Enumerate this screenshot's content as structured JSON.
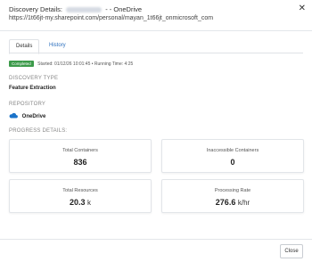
{
  "dialog": {
    "title_prefix": "Discovery Details:",
    "title_suffix": "- - OneDrive",
    "subtitle_url": "https://1t66jt-my.sharepoint.com/personal/mayan_1t66jt_onmicrosoft_com",
    "close_icon": "close-icon"
  },
  "tabs": [
    {
      "label": "Details",
      "active": true
    },
    {
      "label": "History",
      "active": false
    }
  ],
  "status": {
    "badge": "Completed",
    "text": "Started: 01/12/26 10:01:45 • Running Time: 4:25",
    "badge_color": "#3c9a4a"
  },
  "discovery_type": {
    "label": "DISCOVERY TYPE",
    "value": "Feature Extraction"
  },
  "repository": {
    "label": "REPOSITORY",
    "value": "OneDrive",
    "icon": "onedrive-cloud-icon",
    "icon_color": "#1a73c9"
  },
  "progress": {
    "label": "PROGRESS DETAILS:",
    "cards": [
      {
        "label": "Total Containers",
        "value": "836",
        "unit": ""
      },
      {
        "label": "Inaccessible Containers",
        "value": "0",
        "unit": ""
      },
      {
        "label": "Total Resources",
        "value": "20.3",
        "unit": "k"
      },
      {
        "label": "Processing Rate",
        "value": "276.6",
        "unit": "k/hr"
      }
    ]
  },
  "footer": {
    "close_label": "Close"
  }
}
